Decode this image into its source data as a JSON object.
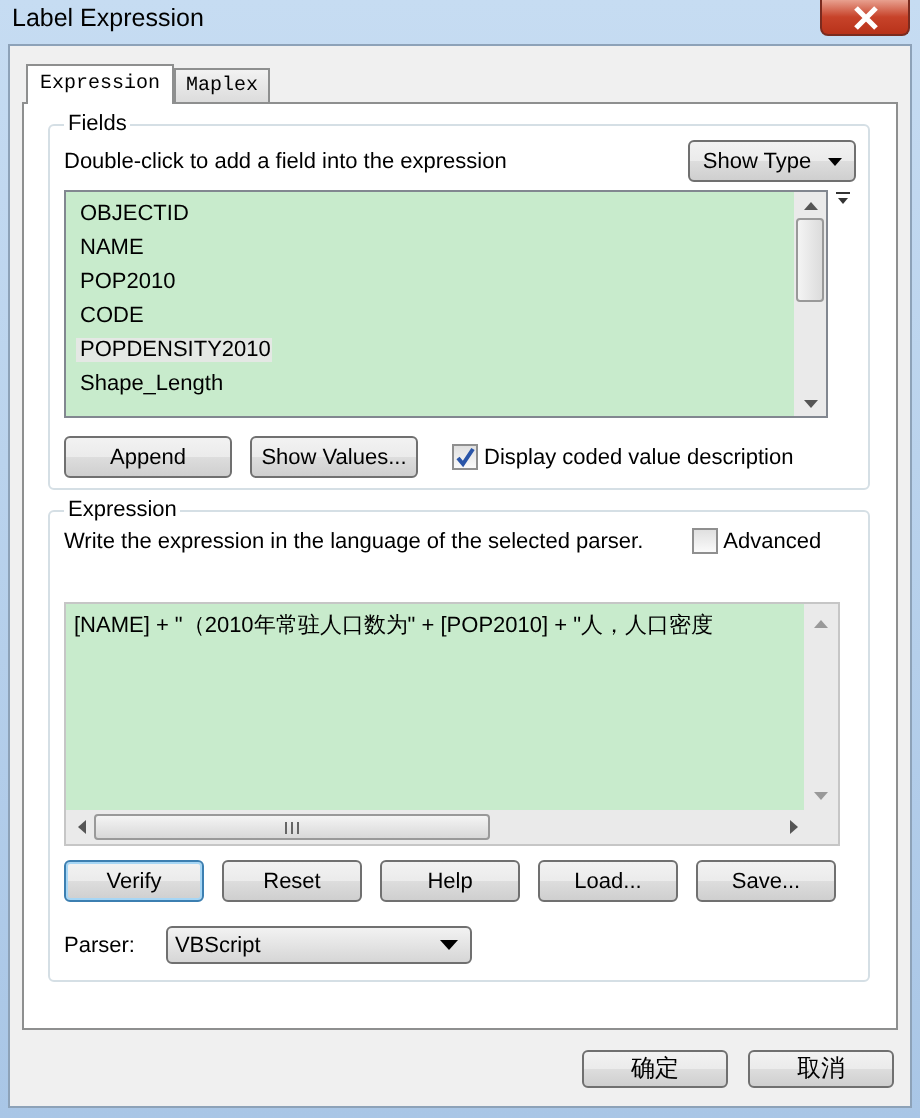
{
  "window": {
    "title": "Label Expression"
  },
  "tabs": [
    {
      "label": "Expression",
      "selected": true
    },
    {
      "label": "Maplex",
      "selected": false
    }
  ],
  "fields_group": {
    "title": "Fields",
    "hint": "Double-click to add a field into the expression",
    "show_type_button": "Show Type",
    "fields": [
      {
        "name": "OBJECTID",
        "selected": false
      },
      {
        "name": "NAME",
        "selected": false
      },
      {
        "name": "POP2010",
        "selected": false
      },
      {
        "name": "CODE",
        "selected": false
      },
      {
        "name": "POPDENSITY2010",
        "selected": true
      },
      {
        "name": "Shape_Length",
        "selected": false
      }
    ],
    "buttons": [
      "Append",
      "Show Values..."
    ],
    "display_coded": {
      "label": "Display coded value description",
      "checked": true
    }
  },
  "expression_group": {
    "title": "Expression",
    "hint": "Write the expression in the language of the selected parser.",
    "advanced": {
      "label": "Advanced",
      "checked": false
    },
    "value": "[NAME] + \"（2010年常驻人口数为\" + [POP2010] + \"人，人口密度",
    "buttons": [
      {
        "label": "Verify",
        "focused": true
      },
      {
        "label": "Reset",
        "focused": false
      },
      {
        "label": "Help",
        "focused": false
      },
      {
        "label": "Load...",
        "focused": false
      },
      {
        "label": "Save...",
        "focused": false
      }
    ],
    "parser_label": "Parser:",
    "parser": "VBScript"
  },
  "dialog_buttons": [
    "确定",
    "取消"
  ]
}
